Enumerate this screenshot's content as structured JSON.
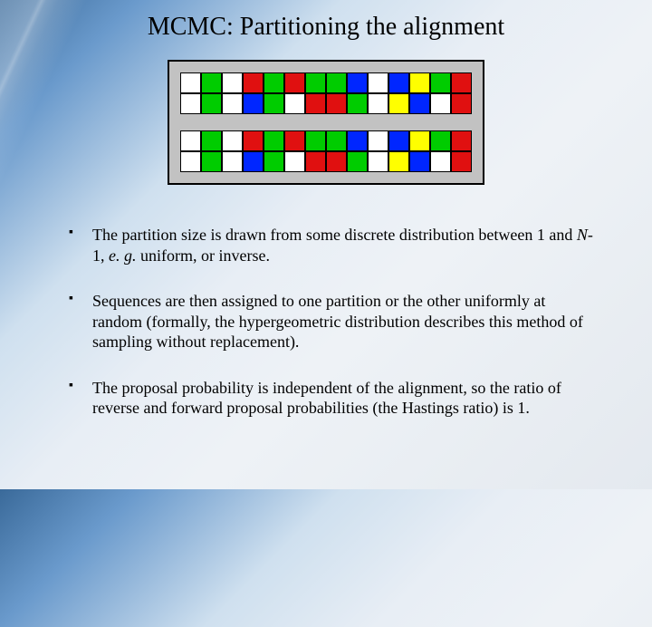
{
  "title": "MCMC: Partitioning the alignment",
  "colors": {
    "white": "#ffffff",
    "green": "#00cc00",
    "red": "#e01010",
    "blue": "#0026ff",
    "yellow": "#ffff00"
  },
  "grids": [
    [
      [
        "white",
        "green",
        "white",
        "red",
        "green",
        "red",
        "green",
        "green",
        "blue",
        "white",
        "blue",
        "yellow",
        "green",
        "red"
      ],
      [
        "white",
        "green",
        "white",
        "blue",
        "green",
        "white",
        "red",
        "red",
        "green",
        "white",
        "yellow",
        "blue",
        "white",
        "red"
      ]
    ],
    [
      [
        "white",
        "green",
        "white",
        "red",
        "green",
        "red",
        "green",
        "green",
        "blue",
        "white",
        "blue",
        "yellow",
        "green",
        "red"
      ],
      [
        "white",
        "green",
        "white",
        "blue",
        "green",
        "white",
        "red",
        "red",
        "green",
        "white",
        "yellow",
        "blue",
        "white",
        "red"
      ]
    ]
  ],
  "bullets": [
    {
      "pre": "The partition size is drawn from some discrete distribution between 1 and ",
      "i1": "N",
      "mid1": "-1, ",
      "i2": "e. g.",
      "post": " uniform, or inverse."
    },
    {
      "pre": "Sequences are then assigned to one partition or the other uniformly at random (formally, the hypergeometric distribution describes this method of sampling without replacement).",
      "i1": "",
      "mid1": "",
      "i2": "",
      "post": ""
    },
    {
      "pre": "The proposal probability is independent of the alignment, so the ratio of reverse and forward proposal probabilities (the Hastings ratio) is 1.",
      "i1": "",
      "mid1": "",
      "i2": "",
      "post": ""
    }
  ]
}
